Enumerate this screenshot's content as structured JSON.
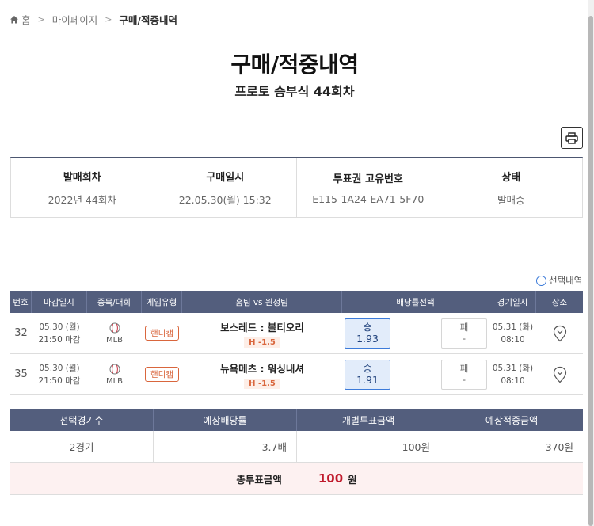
{
  "breadcrumb": {
    "home": "홈",
    "mypage": "마이페이지",
    "current": "구매/적중내역"
  },
  "page": {
    "title": "구매/적중내역",
    "subtitle": "프로토 승부식 44회차"
  },
  "info": {
    "headers": [
      "발매회차",
      "구매일시",
      "투표권 고유번호",
      "상태"
    ],
    "values": [
      "2022년 44회차",
      "22.05.30(월) 15:32",
      "E115-1A24-EA71-5F70",
      "발매중"
    ]
  },
  "select_toggle": {
    "label": "선택내역"
  },
  "games": {
    "headers": [
      "번호",
      "마감일시",
      "종목/대회",
      "게임유형",
      "홈팀 vs 원정팀",
      "배당률선택",
      "경기일시",
      "장소"
    ],
    "rows": [
      {
        "no": "32",
        "deadline_date": "05.30 (월)",
        "deadline_time": "21:50 마감",
        "league": "MLB",
        "game_type": "핸디캡",
        "teams": "보스레드 : 볼티오리",
        "handicap": "H -1.5",
        "win_label": "승",
        "win_odds": "1.93",
        "draw": "-",
        "loss_label": "패",
        "loss_odds": "-",
        "game_date": "05.31 (화)",
        "game_time": "08:10"
      },
      {
        "no": "35",
        "deadline_date": "05.30 (월)",
        "deadline_time": "21:50 마감",
        "league": "MLB",
        "game_type": "핸디캡",
        "teams": "뉴욕메츠 : 워싱내셔",
        "handicap": "H -1.5",
        "win_label": "승",
        "win_odds": "1.91",
        "draw": "-",
        "loss_label": "패",
        "loss_odds": "-",
        "game_date": "05.31 (화)",
        "game_time": "08:10"
      }
    ]
  },
  "summary": {
    "headers": [
      "선택경기수",
      "예상배당률",
      "개별투표금액",
      "예상적중금액"
    ],
    "values": [
      "2경기",
      "3.7배",
      "100원",
      "370원"
    ],
    "total_label": "총투표금액",
    "total_amount": "100",
    "total_unit": "원"
  },
  "colors": {
    "header_bg": "#535e7d",
    "selected_odd": "#e2ecfa",
    "accent_red": "#c01a2c",
    "handicap": "#d9663d"
  },
  "icons": {
    "home": "home-icon",
    "print": "printer-icon",
    "sport": "baseball-icon",
    "place": "location-pin-icon"
  }
}
